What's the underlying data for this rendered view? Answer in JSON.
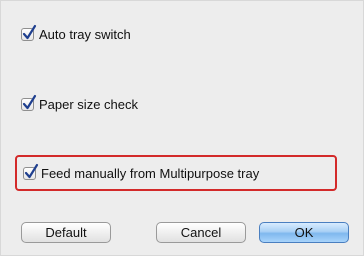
{
  "options": {
    "auto_tray_switch": {
      "label": "Auto tray switch",
      "checked": true
    },
    "paper_size_check": {
      "label": "Paper size check",
      "checked": true
    },
    "feed_manually": {
      "label": "Feed manually from Multipurpose tray",
      "checked": true
    }
  },
  "buttons": {
    "default_label": "Default",
    "cancel_label": "Cancel",
    "ok_label": "OK"
  },
  "colors": {
    "highlight": "#d32a2a",
    "checkmark": "#1f3f8f",
    "ok_button": "#9ccaf5"
  }
}
